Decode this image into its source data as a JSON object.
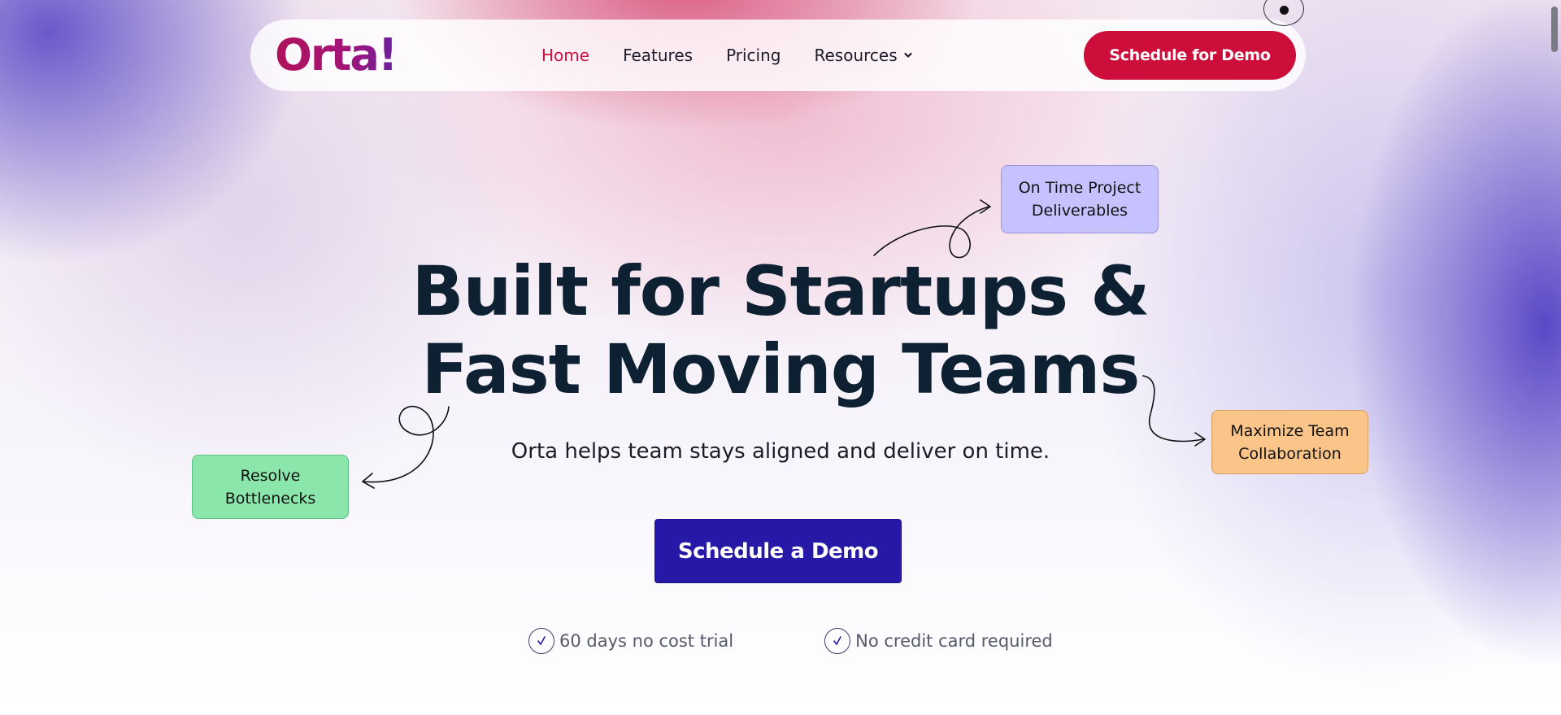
{
  "brand": {
    "logo_text": "Orta!",
    "accent": "#cd0d3a",
    "primary": "#2719a8",
    "heading": "#0e2133"
  },
  "nav": {
    "items": [
      {
        "label": "Home",
        "active": true
      },
      {
        "label": "Features",
        "active": false
      },
      {
        "label": "Pricing",
        "active": false
      },
      {
        "label": "Resources",
        "active": false,
        "has_dropdown": true
      }
    ],
    "cta_label": "Schedule for Demo"
  },
  "hero": {
    "title_line1": "Built for Startups &",
    "title_line2": "Fast Moving Teams",
    "subtitle": "Orta helps team stays aligned and deliver on time.",
    "cta_label": "Schedule a Demo",
    "perks": [
      {
        "label": "60 days no cost trial",
        "icon": "check-circle-icon"
      },
      {
        "label": "No credit card required",
        "icon": "check-circle-icon"
      }
    ]
  },
  "tags": {
    "on_time": {
      "line1": "On Time Project",
      "line2": "Deliverables",
      "color": "#c6c2ff"
    },
    "resolve": {
      "line1": "Resolve",
      "line2": "Bottlenecks",
      "color": "#8ae6ab"
    },
    "maximize": {
      "line1": "Maximize Team",
      "line2": "Collaboration",
      "color": "#fbc58a"
    }
  }
}
